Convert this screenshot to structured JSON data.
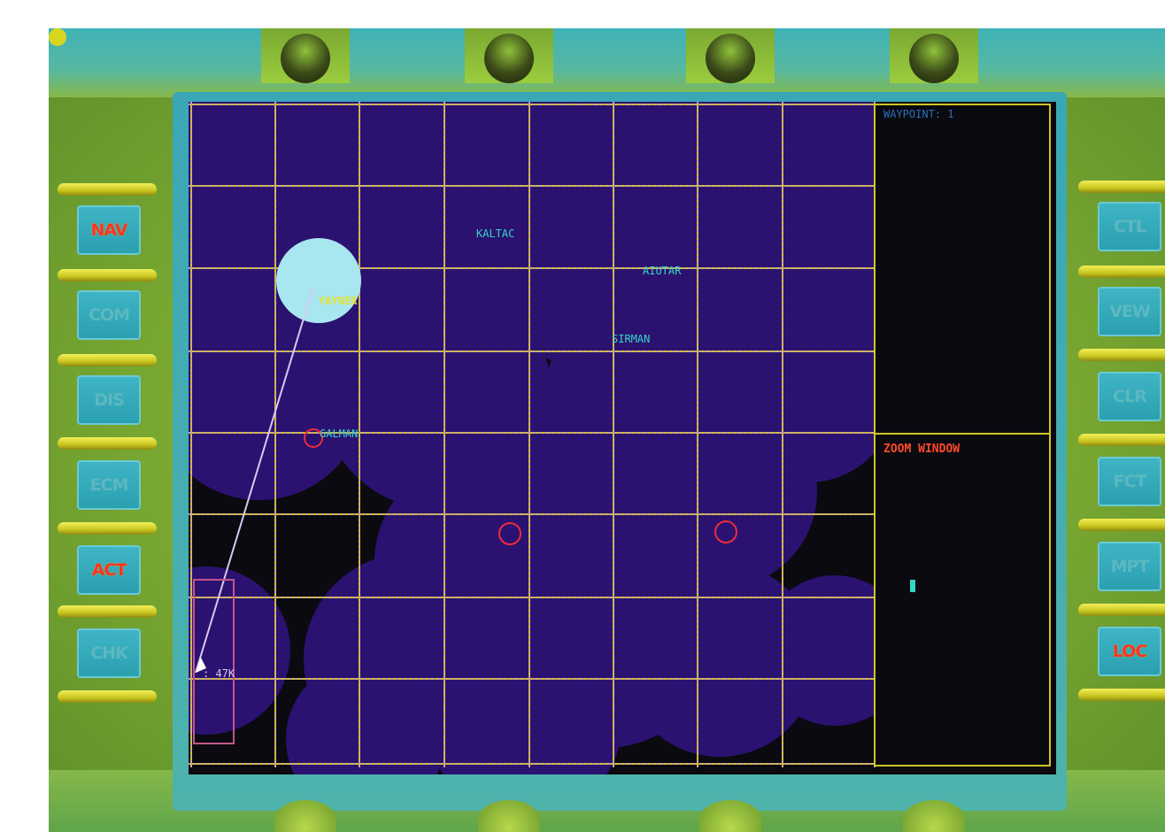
{
  "left_buttons": [
    {
      "label": "NAV",
      "lit": true
    },
    {
      "label": "COM",
      "lit": false
    },
    {
      "label": "DIS",
      "lit": false
    },
    {
      "label": "ECM",
      "lit": false
    },
    {
      "label": "ACT",
      "lit": true
    },
    {
      "label": "CHK",
      "lit": false
    }
  ],
  "right_buttons": [
    {
      "label": "CTL",
      "lit": false
    },
    {
      "label": "VEW",
      "lit": false
    },
    {
      "label": "CLR",
      "lit": false
    },
    {
      "label": "FCT",
      "lit": false
    },
    {
      "label": "MPT",
      "lit": false
    },
    {
      "label": "LOC",
      "lit": true
    }
  ],
  "map": {
    "labels": [
      {
        "text": "KALTAC",
        "color": "#35d6c6"
      },
      {
        "text": "YAYNER",
        "color": "#e8e030"
      },
      {
        "text": "AIUTAR",
        "color": "#35d6c6"
      },
      {
        "text": "SIRMAN",
        "color": "#35d6c6"
      },
      {
        "text": "GALMAN",
        "color": "#35d6c6"
      }
    ],
    "range_text": ": 47K"
  },
  "info_panel": {
    "top_label": "WAYPOINT: 1",
    "zoom_label": "ZOOM WINDOW"
  },
  "colors": {
    "coverage": "#2b1270",
    "grid_yellow": "#cfc624",
    "grid_pink": "#c78fd6",
    "threat_red": "#ee2a3c",
    "player_glow": "#a8e6f0"
  }
}
